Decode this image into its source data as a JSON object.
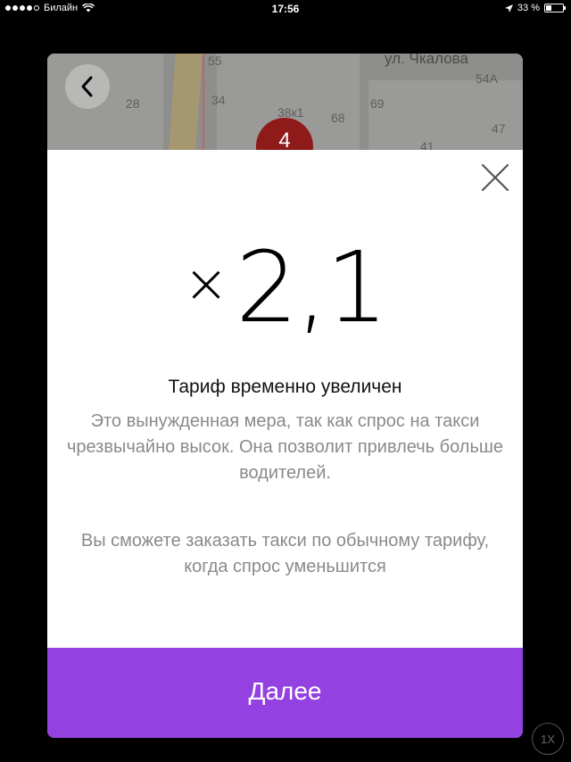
{
  "status_bar": {
    "carrier": "Билайн",
    "time": "17:56",
    "battery_text": "33 %",
    "battery_level": 0.33,
    "signal_bars": 4
  },
  "map": {
    "street_label": "ул. Чкалова",
    "house_numbers": [
      "55",
      "28",
      "34",
      "38к1",
      "68",
      "69",
      "54А",
      "47",
      "41"
    ],
    "pin_label": "4",
    "back_icon": "chevron-left-icon"
  },
  "surge": {
    "times_sign": "×",
    "multiplier": "2,1",
    "title": "Тариф временно увеличен",
    "description": "Это вынужденная мера, так как спрос на такси чрезвычайно высок. Она позволит привлечь больше водителей.",
    "note": "Вы сможете заказать такси по обычному тарифу, когда спрос уменьшится",
    "close_icon": "close-icon"
  },
  "footer": {
    "next_label": "Далее",
    "accent_color": "#9441e2"
  },
  "overlay": {
    "speed_badge": "1X"
  }
}
